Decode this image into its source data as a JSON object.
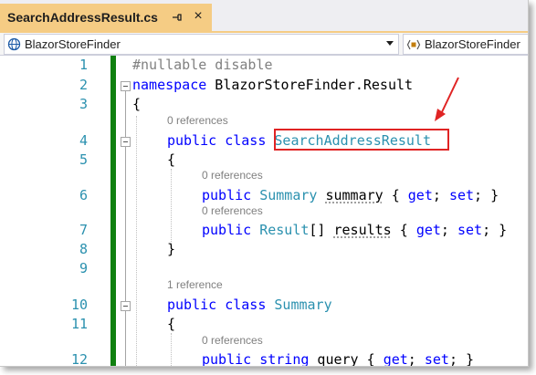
{
  "tab": {
    "title": "SearchAddressResult.cs",
    "pin_icon": "pin-icon",
    "close_label": "×"
  },
  "navbar": {
    "project": "BlazorStoreFinder",
    "scope": "BlazorStoreFinder"
  },
  "editor": {
    "line_numbers": [
      "1",
      "2",
      "3",
      "4",
      "5",
      "6",
      "7",
      "8",
      "9",
      "10",
      "11",
      "12"
    ],
    "lens": {
      "refs_0_a": "0 references",
      "refs_0_b": "0 references",
      "refs_0_c": "0 references",
      "refs_1": "1 reference",
      "refs_0_d": "0 references"
    },
    "code": {
      "l1": "#nullable disable",
      "l2_kw": "namespace",
      "l2_rest": " BlazorStoreFinder.Result",
      "l3": "{",
      "l4_kw": "public class",
      "l4_type": "SearchAddressResult",
      "l5": "{",
      "l6_kw": "public",
      "l6_type": "Summary",
      "l6_name": "summary",
      "l6_open": " { ",
      "l6_get": "get",
      "l6_mid": "; ",
      "l6_set": "set",
      "l6_close": "; }",
      "l7_kw": "public",
      "l7_type": "Result",
      "l7_arr": "[] ",
      "l7_name": "results",
      "l7_open": " { ",
      "l7_get": "get",
      "l7_mid": "; ",
      "l7_set": "set",
      "l7_close": "; }",
      "l8": "}",
      "l10_kw": "public class",
      "l10_type": "Summary",
      "l11": "{",
      "l12_kw": "public string",
      "l12_name": " query",
      "l12_open": " { ",
      "l12_get": "get",
      "l12_mid": "; ",
      "l12_set": "set",
      "l12_close": "; }"
    }
  },
  "colors": {
    "accent_tab": "#f5cc84",
    "keyword": "#0000ff",
    "type": "#2b91af",
    "changes_bar": "#108010",
    "highlight": "#e02424"
  }
}
